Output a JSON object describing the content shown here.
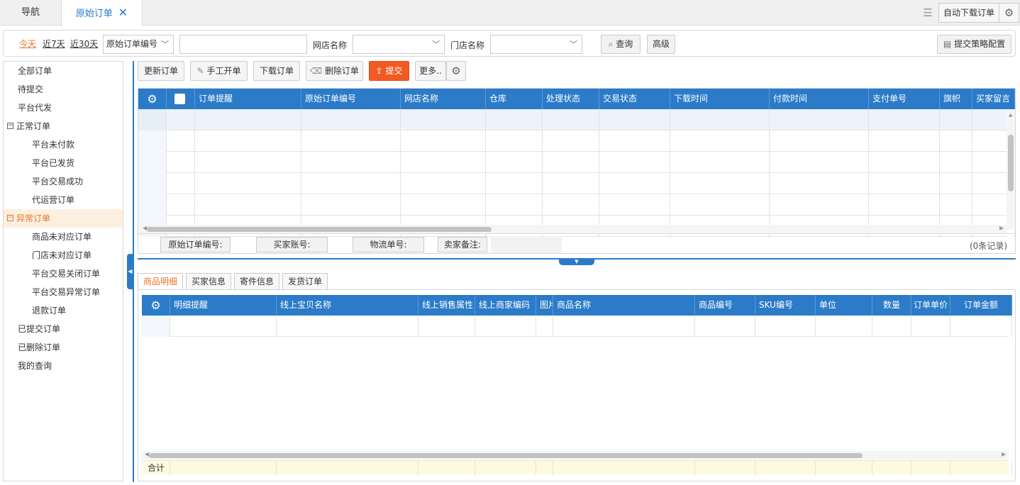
{
  "tabs": {
    "nav": "导航",
    "current": "原始订单",
    "close": "✕"
  },
  "top_actions": {
    "auto_download": "自动下载订单"
  },
  "filter": {
    "quick": [
      "今天",
      "近7天",
      "近30天"
    ],
    "field_select": "原始订单编号",
    "field_input": "",
    "shop_label": "网店名称",
    "shop_value": "",
    "store_label": "门店名称",
    "store_value": "",
    "query": "查询",
    "advanced": "高级",
    "strategy": "提交策略配置"
  },
  "sidebar": {
    "items": [
      {
        "label": "全部订单",
        "level": 0
      },
      {
        "label": "待提交",
        "level": 0
      },
      {
        "label": "平台代发",
        "level": 0
      },
      {
        "label": "正常订单",
        "level": 0,
        "toggle": "−"
      },
      {
        "label": "平台未付款",
        "level": 1
      },
      {
        "label": "平台已发货",
        "level": 1
      },
      {
        "label": "平台交易成功",
        "level": 1
      },
      {
        "label": "代运营订单",
        "level": 1
      },
      {
        "label": "异常订单",
        "level": 0,
        "toggle": "−",
        "active": true
      },
      {
        "label": "商品未对应订单",
        "level": 1
      },
      {
        "label": "门店未对应订单",
        "level": 1
      },
      {
        "label": "平台交易关闭订单",
        "level": 1
      },
      {
        "label": "平台交易异常订单",
        "level": 1
      },
      {
        "label": "退款订单",
        "level": 1
      },
      {
        "label": "已提交订单",
        "level": 0
      },
      {
        "label": "已删除订单",
        "level": 0
      },
      {
        "label": "我的查询",
        "level": 0
      }
    ]
  },
  "toolbar": {
    "refresh": "更新订单",
    "manual": "手工开单",
    "download": "下载订单",
    "delete": "删除订单",
    "submit": "提交",
    "more": "更多.."
  },
  "grid1": {
    "columns": [
      "订单提醒",
      "原始订单编号",
      "网店名称",
      "仓库",
      "处理状态",
      "交易状态",
      "下载时间",
      "付款时间",
      "支付单号",
      "旗帜",
      "买家留言"
    ],
    "footer_tags": [
      "原始订单编号:",
      "买家账号:",
      "物流单号:",
      "卖家备注:"
    ],
    "record_count": "(0条记录)"
  },
  "detail_tabs": [
    "商品明细",
    "买家信息",
    "寄件信息",
    "发货订单"
  ],
  "grid2": {
    "columns": [
      "明细提醒",
      "线上宝贝名称",
      "线上销售属性",
      "线上商家编码",
      "图片",
      "商品名称",
      "商品编号",
      "SKU编号",
      "单位",
      "数量",
      "订单单价",
      "订单金额"
    ],
    "sum_label": "合计"
  },
  "colors": {
    "accent_blue": "#2b7bc8",
    "accent_orange": "#e8742b",
    "submit_red": "#f25a23"
  }
}
